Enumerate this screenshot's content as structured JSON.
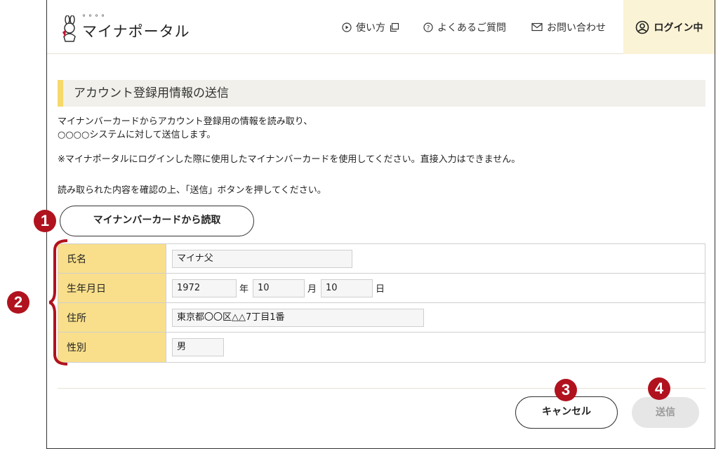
{
  "header": {
    "logo_text": "マイナポータル",
    "nav": {
      "how_to": "使い方",
      "faq": "よくあるご質問",
      "contact": "お問い合わせ",
      "login": "ログイン中"
    }
  },
  "section": {
    "title": "アカウント登録用情報の送信",
    "desc_line1": "マイナンバーカードからアカウント登録用の情報を読み取り、",
    "desc_line2": "○○○○システムに対して送信します。",
    "note": "※マイナポータルにログインした際に使用したマイナンバーカードを使用してください。直接入力はできません。",
    "instruction": "読み取られた内容を確認の上、「送信」ボタンを押してください。"
  },
  "read_button": "マイナンバーカードから読取",
  "form": {
    "name_label": "氏名",
    "name_value": "マイナ父",
    "birth_label": "生年月日",
    "birth_year": "1972",
    "year_unit": "年",
    "birth_month": "10",
    "month_unit": "月",
    "birth_day": "10",
    "day_unit": "日",
    "address_label": "住所",
    "address_value": "東京都〇〇区△△7丁目1番",
    "gender_label": "性別",
    "gender_value": "男"
  },
  "buttons": {
    "cancel": "キャンセル",
    "send": "送信"
  },
  "callouts": [
    "1",
    "2",
    "3",
    "4"
  ],
  "colors": {
    "accent_yellow": "#f6d96b",
    "label_bg": "#f9df8b",
    "login_bg": "#fbf3d6",
    "callout": "#b0121e",
    "disabled_button": "#e6e6e6"
  }
}
